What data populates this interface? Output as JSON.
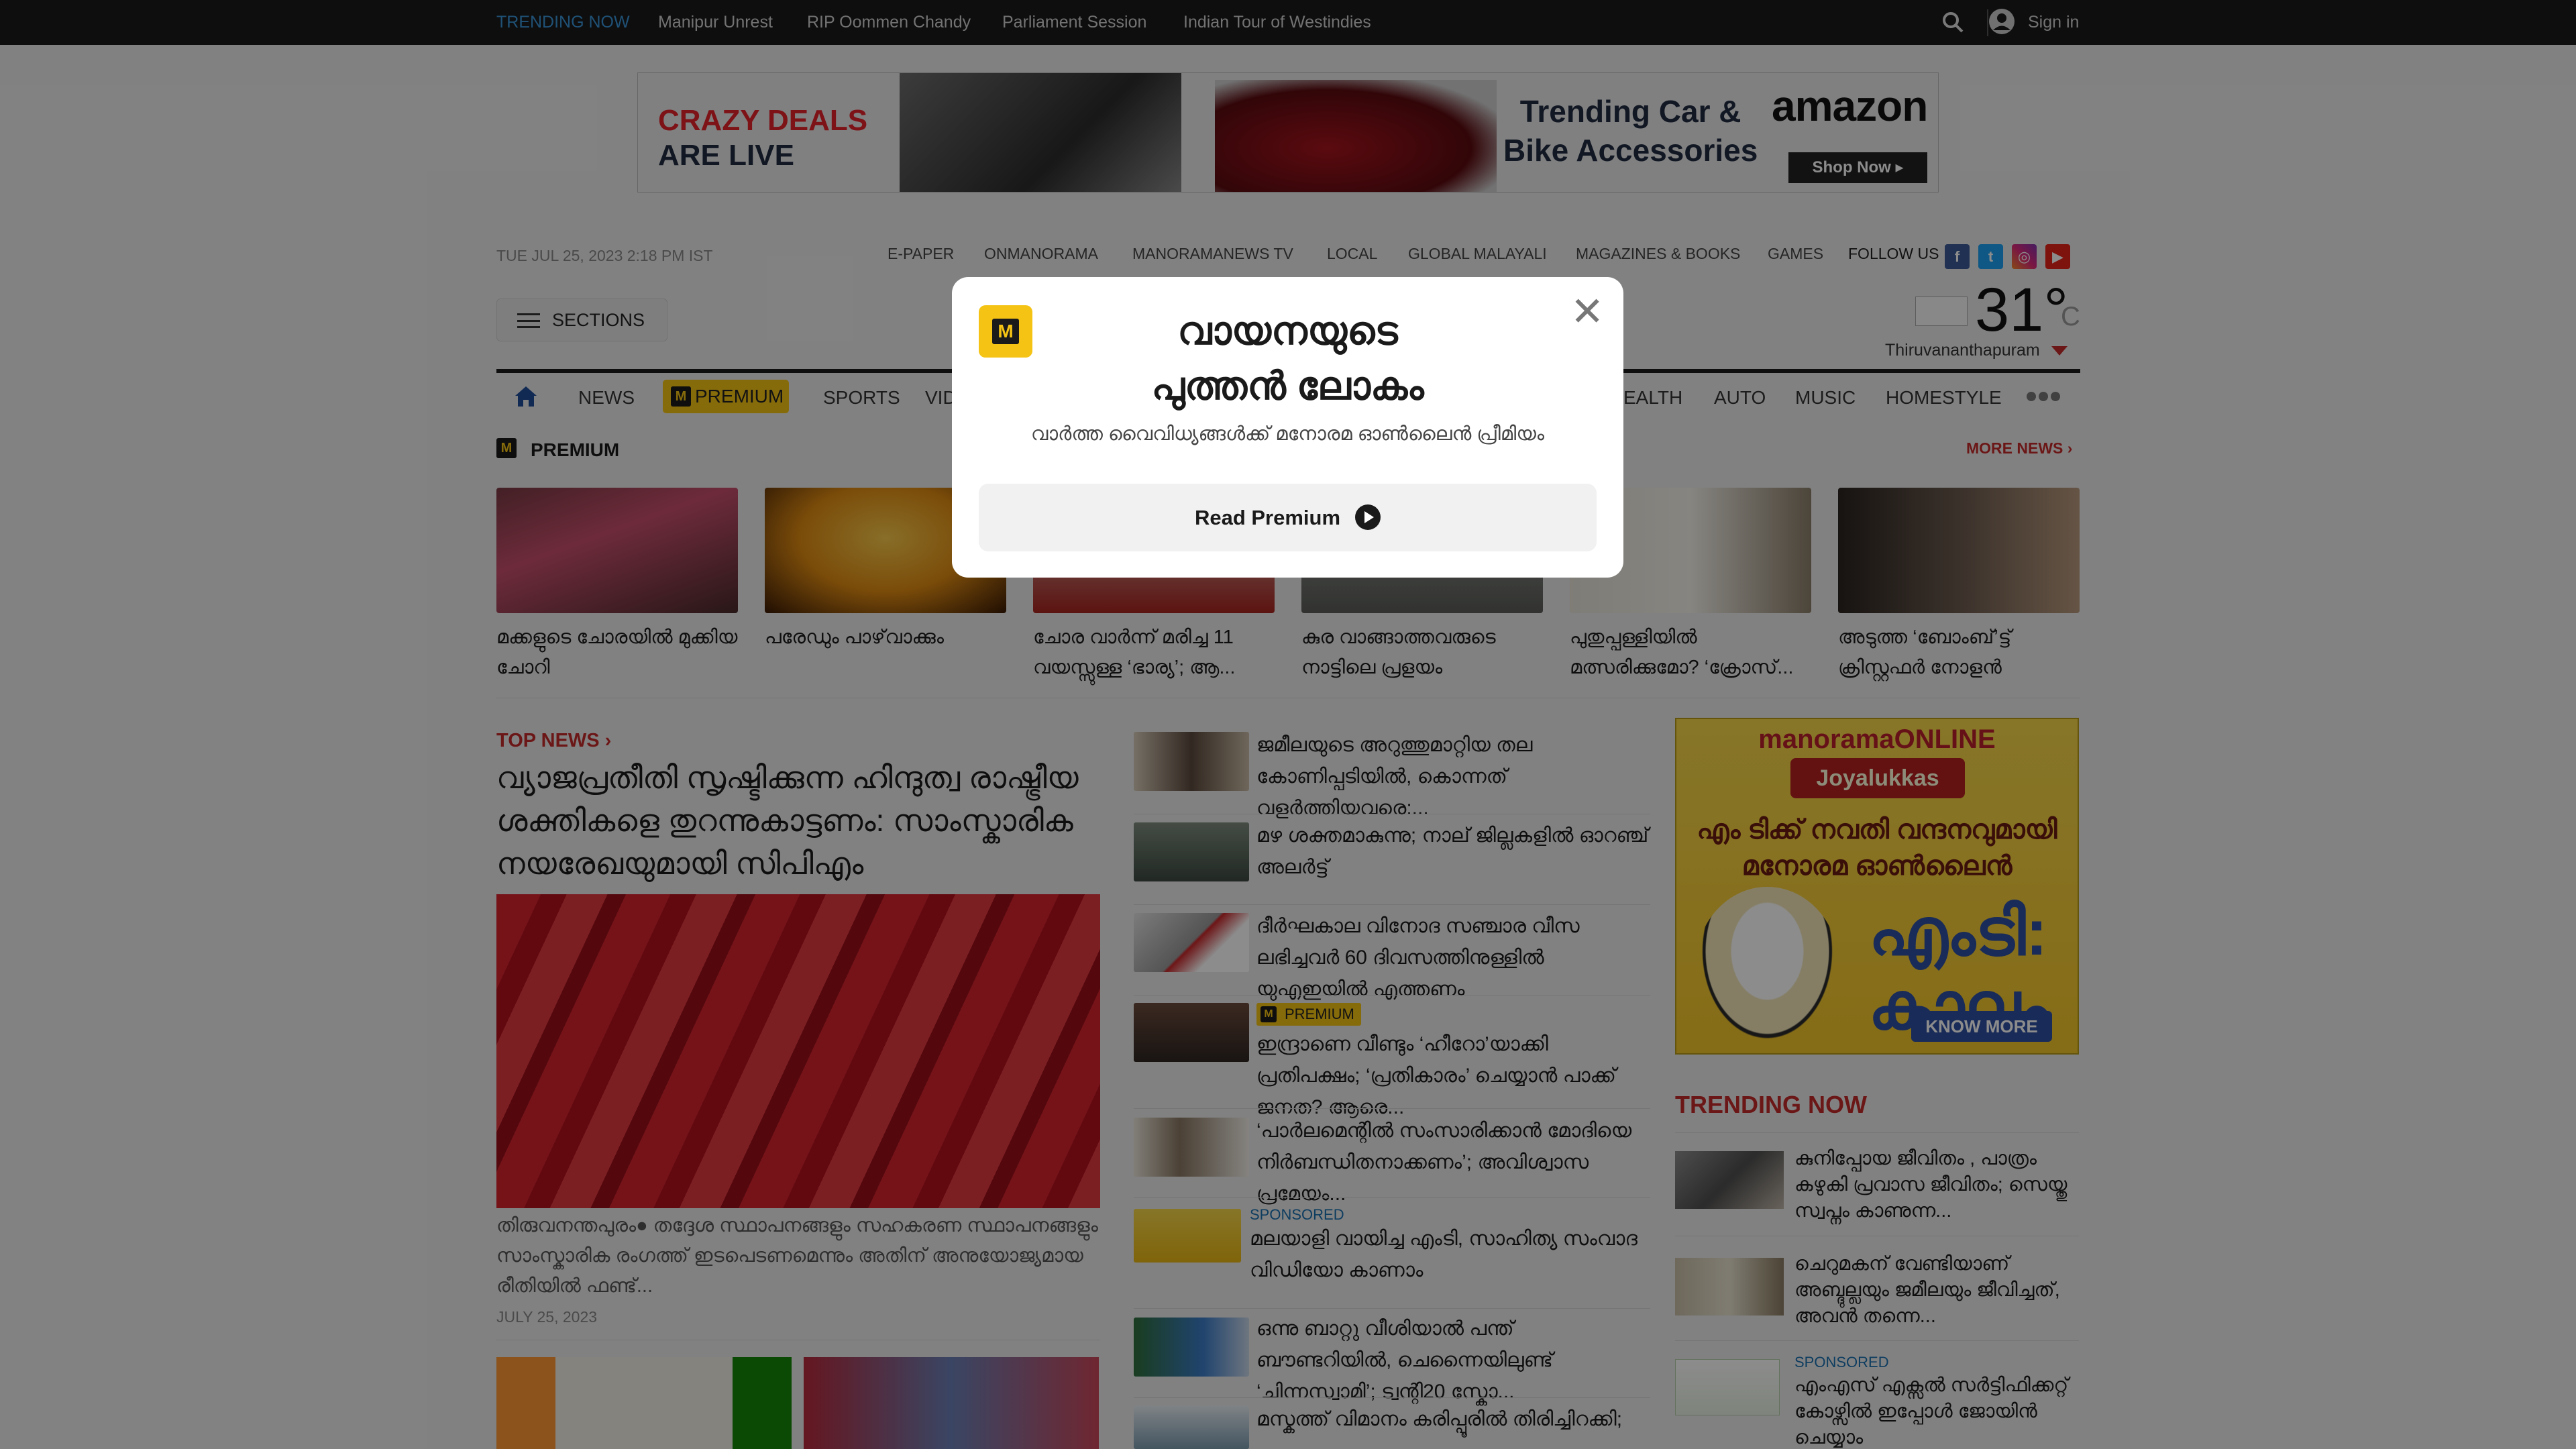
{
  "trending_bar": {
    "label": "TRENDING NOW",
    "links": [
      "Manipur Unrest",
      "RIP Oommen Chandy",
      "Parliament Session",
      "Indian Tour of Westindies"
    ],
    "sign_in": "Sign in"
  },
  "top_ad": {
    "crazy_1": "CRAZY DEALS",
    "crazy_2": "ARE LIVE",
    "trending_1": "Trending Car &",
    "trending_2": "Bike Accessories",
    "brand": "amazon",
    "cta": "Shop Now ▸"
  },
  "header": {
    "date": "TUE JUL 25, 2023 2:18 PM IST",
    "links": [
      "E-PAPER",
      "ONMANORAMA",
      "MANORAMANEWS TV",
      "LOCAL",
      "GLOBAL MALAYALI",
      "MAGAZINES & BOOKS",
      "GAMES"
    ],
    "follow_us": "FOLLOW US",
    "sections": "SECTIONS",
    "temperature": "31°",
    "unit": "C",
    "city": "Thiruvananthapuram"
  },
  "main_nav": {
    "items": [
      "NEWS",
      "PREMIUM",
      "SPORTS",
      "VIDEO",
      "EALTH",
      "AUTO",
      "MUSIC",
      "HOMESTYLE"
    ]
  },
  "premium_section": {
    "title": "PREMIUM",
    "more": "MORE NEWS",
    "cards": [
      "മക്കളുടെ ചോരയിൽ മുക്കിയ ചോറി",
      "പരേഡും പാഴ്‌വാക്കും",
      "ചോര വാർന്ന് മരിച്ച 11 വയസ്സുള്ള ‘ഭാര്യ’; ആ...",
      "കുര വാങ്ങാത്തവരുടെ നാട്ടിലെ പ്രളയം",
      "പുതുപ്പള്ളിയിൽ മത്സരിക്കുമോ? ‘ക്രോസ്...",
      "അടുത്ത ‘ബോംബ്’ട്ട് ക്രിസ്റ്റഫർ നോളൻ"
    ]
  },
  "top_news": {
    "label": "TOP NEWS",
    "headline": "വ്യാജപ്രതീതി സൃഷ്ടിക്കുന്ന ഹിന്ദുത്വ രാഷ്ട്രീയ ശക്തികളെ തുറന്നുകാട്ടണം: സാംസ്കാരിക നയരേഖയുമായി സിപിഎം",
    "summary": "തിരുവനന്തപുരം● തദ്ദേശ സ്ഥാപനങ്ങളും സഹകരണ സ്ഥാപനങ്ങളും സാംസ്കാരിക രംഗത്ത് ഇടപെടണമെന്നും അതിന് അനുയോജ്യമായ രീതിയിൽ ഫണ്ട്...",
    "date": "JULY 25, 2023"
  },
  "mid_list": [
    {
      "text": "ജമീലയുടെ അറുത്തുമാറ്റിയ തല കോണിപ്പടിയിൽ, കൊന്നത് വളർത്തിയവരെ:..."
    },
    {
      "text": "മഴ ശക്തമാകുന്നു; നാല് ജില്ലകളിൽ ഓറഞ്ച് അലർട്ട്"
    },
    {
      "text": "ദീർഘകാല വിനോദ സഞ്ചാര വീസ ലഭിച്ചവർ 60 ദിവസത്തിനുള്ളിൽ യുഎഇയിൽ എത്തണം"
    },
    {
      "text": "ഇന്ദ്രാണെ വീണ്ടും ‘ഹീറോ’യാക്കി പ്രതിപക്ഷം; ‘പ്രതികാരം’ ചെയ്യാൻ പാക്ക് ജനത? ആരെ...",
      "tag": "PREMIUM"
    },
    {
      "text": "‘പാർലമെന്റിൽ സംസാരിക്കാൻ മോദിയെ നിർബന്ധിതനാക്കണം’; അവിശ്വാസ പ്രമേയം..."
    },
    {
      "text": "മലയാളി വായിച്ച എംടി, സാഹിത്യ സംവാദ വിഡിയോ കാണാം",
      "sponsored": "SPONSORED"
    },
    {
      "text": "ഒന്നു ബാറ്റു വീശിയാൽ പന്ത് ബൗണ്ടറിയിൽ, ചെന്നൈയിലുണ്ട് ‘ചിന്നസ്വാമി’; ട്വന്റി20 സ്കോ..."
    },
    {
      "text": "മസ്കത്ത് വിമാനം കരിപ്പൂരിൽ തിരിച്ചിറക്കി;"
    }
  ],
  "side_ad": {
    "brand": "manoramaONLINE",
    "sponsor": "Joyalukkas",
    "line1": "എം ടിക്ക് നവതി വന്ദനവുമായി",
    "line2": "മനോരമ ഓൺലൈൻ",
    "big1": "എംടി:",
    "big2": "കാലം",
    "cta": "KNOW MORE"
  },
  "trending_now": {
    "title": "TRENDING NOW",
    "items": [
      {
        "text": "കുനിപ്പോയ ജീവിതം , പാത്രം കഴുകി പ്രവാസ ജീവിതം; സെയ്തു സ്വപ്നം കാണുന്ന..."
      },
      {
        "text": "ചെറുമകന് വേണ്ടിയാണ് അബ്ദുല്ലയും ജമീലയും ജീവിച്ചത്, അവൻ തന്നെ..."
      },
      {
        "text": "എംഎസ് എക്സൽ സർട്ടിഫിക്കറ്റ് കോഴ്സിൽ ഇപ്പോൾ ജോയിൻ ചെയ്യാം",
        "sponsored": "SPONSORED"
      }
    ]
  },
  "modal": {
    "title_1": "വായനയുടെ",
    "title_2": "പുത്തൻ ലോകം",
    "subtitle": "വാർത്ത വൈവിധ്യങ്ങൾക്ക് മനോരമ ഓൺലൈൻ പ്രീമിയം",
    "button": "Read Premium"
  },
  "colors": {
    "accent_red": "#c52a2a",
    "premium_yellow": "#f4c314",
    "link_blue": "#3a94d8"
  }
}
